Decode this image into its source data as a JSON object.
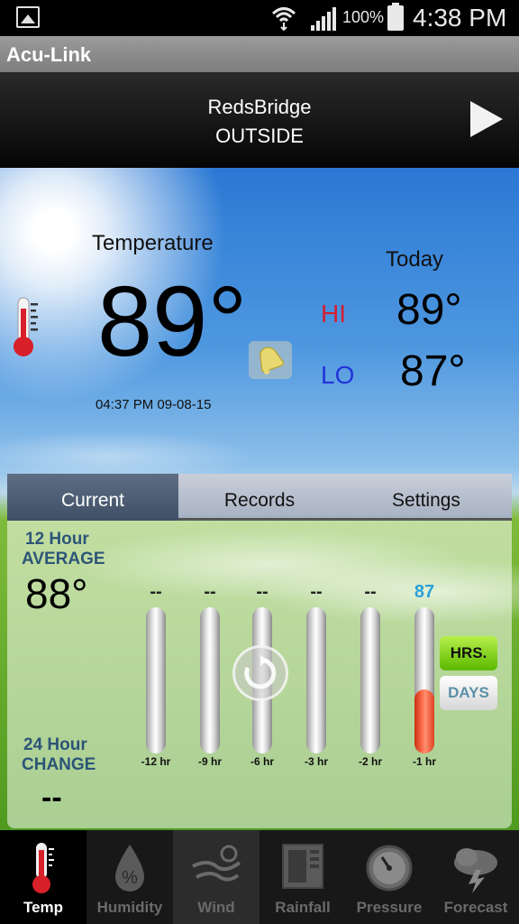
{
  "status_bar": {
    "battery": "100%",
    "time": "4:38 PM",
    "icons": [
      "gallery-icon",
      "wifi-icon",
      "signal-icon",
      "battery-icon"
    ]
  },
  "app": {
    "title": "Acu-Link"
  },
  "station": {
    "name": "RedsBridge",
    "location": "OUTSIDE",
    "next_icon": "play-arrow-icon"
  },
  "current": {
    "label": "Temperature",
    "value": "89°",
    "timestamp": "04:37 PM 09-08-15"
  },
  "today": {
    "label": "Today",
    "hi_label": "HI",
    "hi_value": "89°",
    "lo_label": "LO",
    "lo_value": "87°",
    "hi_color": "#d42030",
    "lo_color": "#2234d8"
  },
  "tabs": [
    {
      "label": "Current",
      "active": true
    },
    {
      "label": "Records",
      "active": false
    },
    {
      "label": "Settings",
      "active": false
    }
  ],
  "average": {
    "line1": "12 Hour",
    "line2": "AVERAGE",
    "value": "88°"
  },
  "change": {
    "line1": "24 Hour",
    "line2": "CHANGE",
    "value": "--"
  },
  "history": {
    "bars": [
      {
        "label": "-12 hr",
        "value": "--",
        "fill": 0
      },
      {
        "label": "-9 hr",
        "value": "--",
        "fill": 0
      },
      {
        "label": "-6 hr",
        "value": "--",
        "fill": 0
      },
      {
        "label": "-3 hr",
        "value": "--",
        "fill": 0
      },
      {
        "label": "-2 hr",
        "value": "--",
        "fill": 0
      },
      {
        "label": "-1 hr",
        "value": "87",
        "fill": 0.44
      }
    ]
  },
  "range_buttons": {
    "hrs": "HRS.",
    "days": "DAYS",
    "active": "HRS."
  },
  "nav": [
    {
      "label": "Temp",
      "icon": "thermometer-icon",
      "selected": true
    },
    {
      "label": "Humidity",
      "icon": "humidity-drop-icon",
      "selected": false
    },
    {
      "label": "Wind",
      "icon": "wind-icon",
      "selected": false
    },
    {
      "label": "Rainfall",
      "icon": "rain-gauge-icon",
      "selected": false
    },
    {
      "label": "Pressure",
      "icon": "barometer-icon",
      "selected": false
    },
    {
      "label": "Forecast",
      "icon": "storm-cloud-icon",
      "selected": false
    }
  ],
  "colors": {
    "accent_blue": "#2aa0d8",
    "label_blue": "#2c5577",
    "bar_red": "#e04020"
  }
}
